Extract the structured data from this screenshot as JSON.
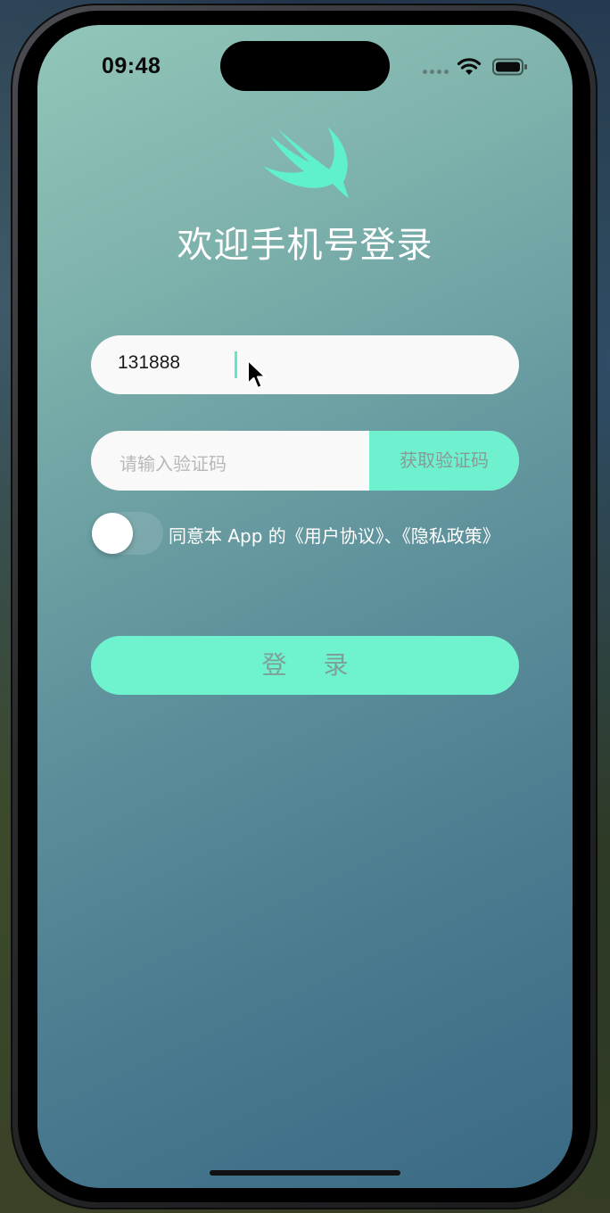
{
  "status_bar": {
    "time": "09:48"
  },
  "header": {
    "logo_icon": "swift-bird-icon",
    "title": "欢迎手机号登录"
  },
  "form": {
    "phone": {
      "value": "131888"
    },
    "code": {
      "placeholder": "请输入验证码",
      "get_code_label": "获取验证码"
    },
    "agreement": {
      "toggle_on": false,
      "text": "同意本 App 的《用户协议》、《隐私政策》"
    },
    "login_label": "登 录"
  },
  "colors": {
    "accent": "#6ff3cf",
    "gradient_start": "#93c6b9",
    "gradient_end": "#3b6a84"
  }
}
